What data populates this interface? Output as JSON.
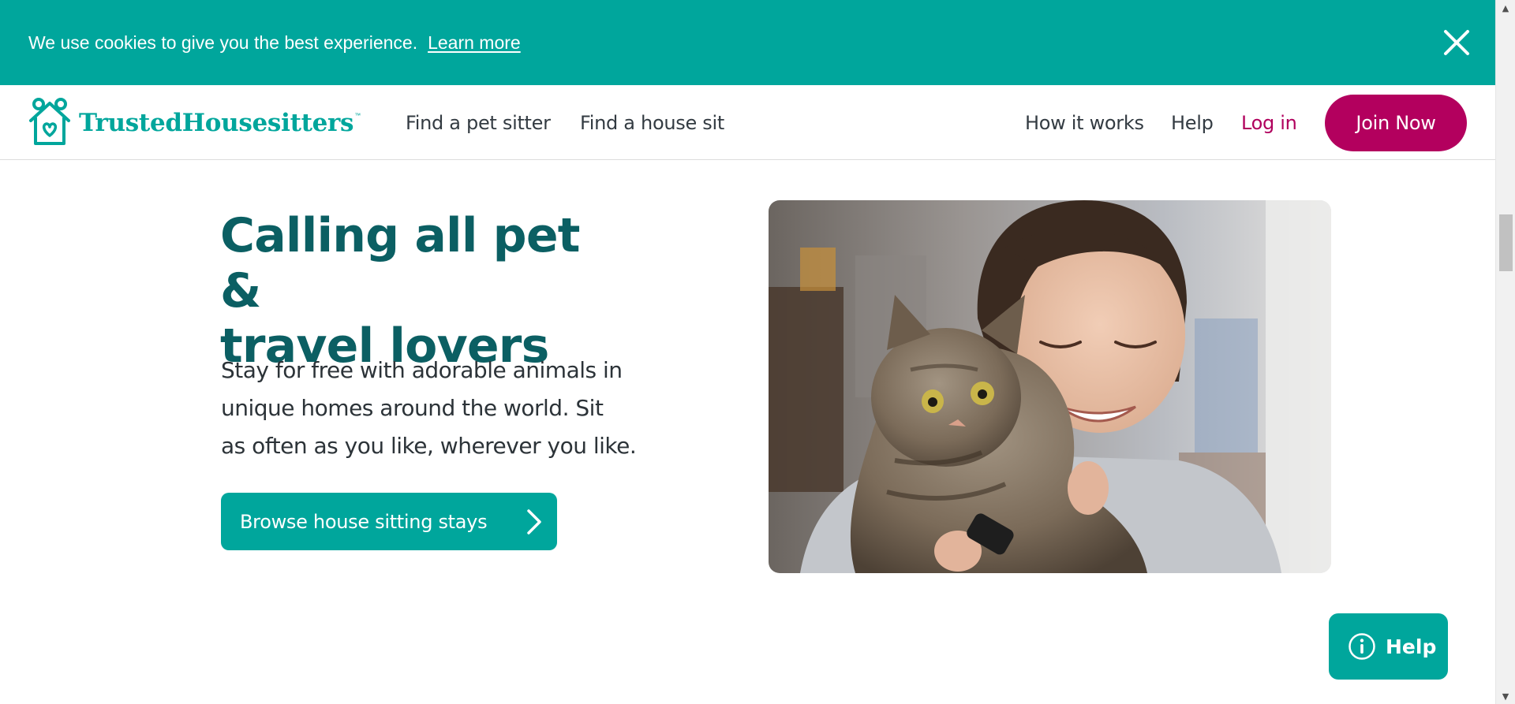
{
  "cookie_banner": {
    "message": "We use cookies to give you the best experience.",
    "link_label": "Learn more",
    "close_icon": "close-icon"
  },
  "header": {
    "logo_text": "TrustedHousesitters",
    "logo_tm": "™",
    "nav_left": [
      "Find a pet sitter",
      "Find a house sit"
    ],
    "nav_right": [
      "How it works",
      "Help"
    ],
    "login_label": "Log in",
    "join_label": "Join Now"
  },
  "hero": {
    "title_line1": "Calling all pet &",
    "title_line2": "travel lovers",
    "subtitle_line1": "Stay for free with adorable animals in",
    "subtitle_line2": "unique homes around the world. Sit",
    "subtitle_line3": "as often as you like, wherever you like.",
    "cta_label": "Browse house sitting stays",
    "cta_icon": "chevron-right-icon",
    "image_icon": "photo-woman-hugging-cat"
  },
  "help_widget": {
    "label": "Help",
    "icon": "info-icon"
  },
  "colors": {
    "teal": "#00a69c",
    "dark_teal": "#0b5f63",
    "magenta": "#b3005e",
    "text": "#2c3338"
  }
}
